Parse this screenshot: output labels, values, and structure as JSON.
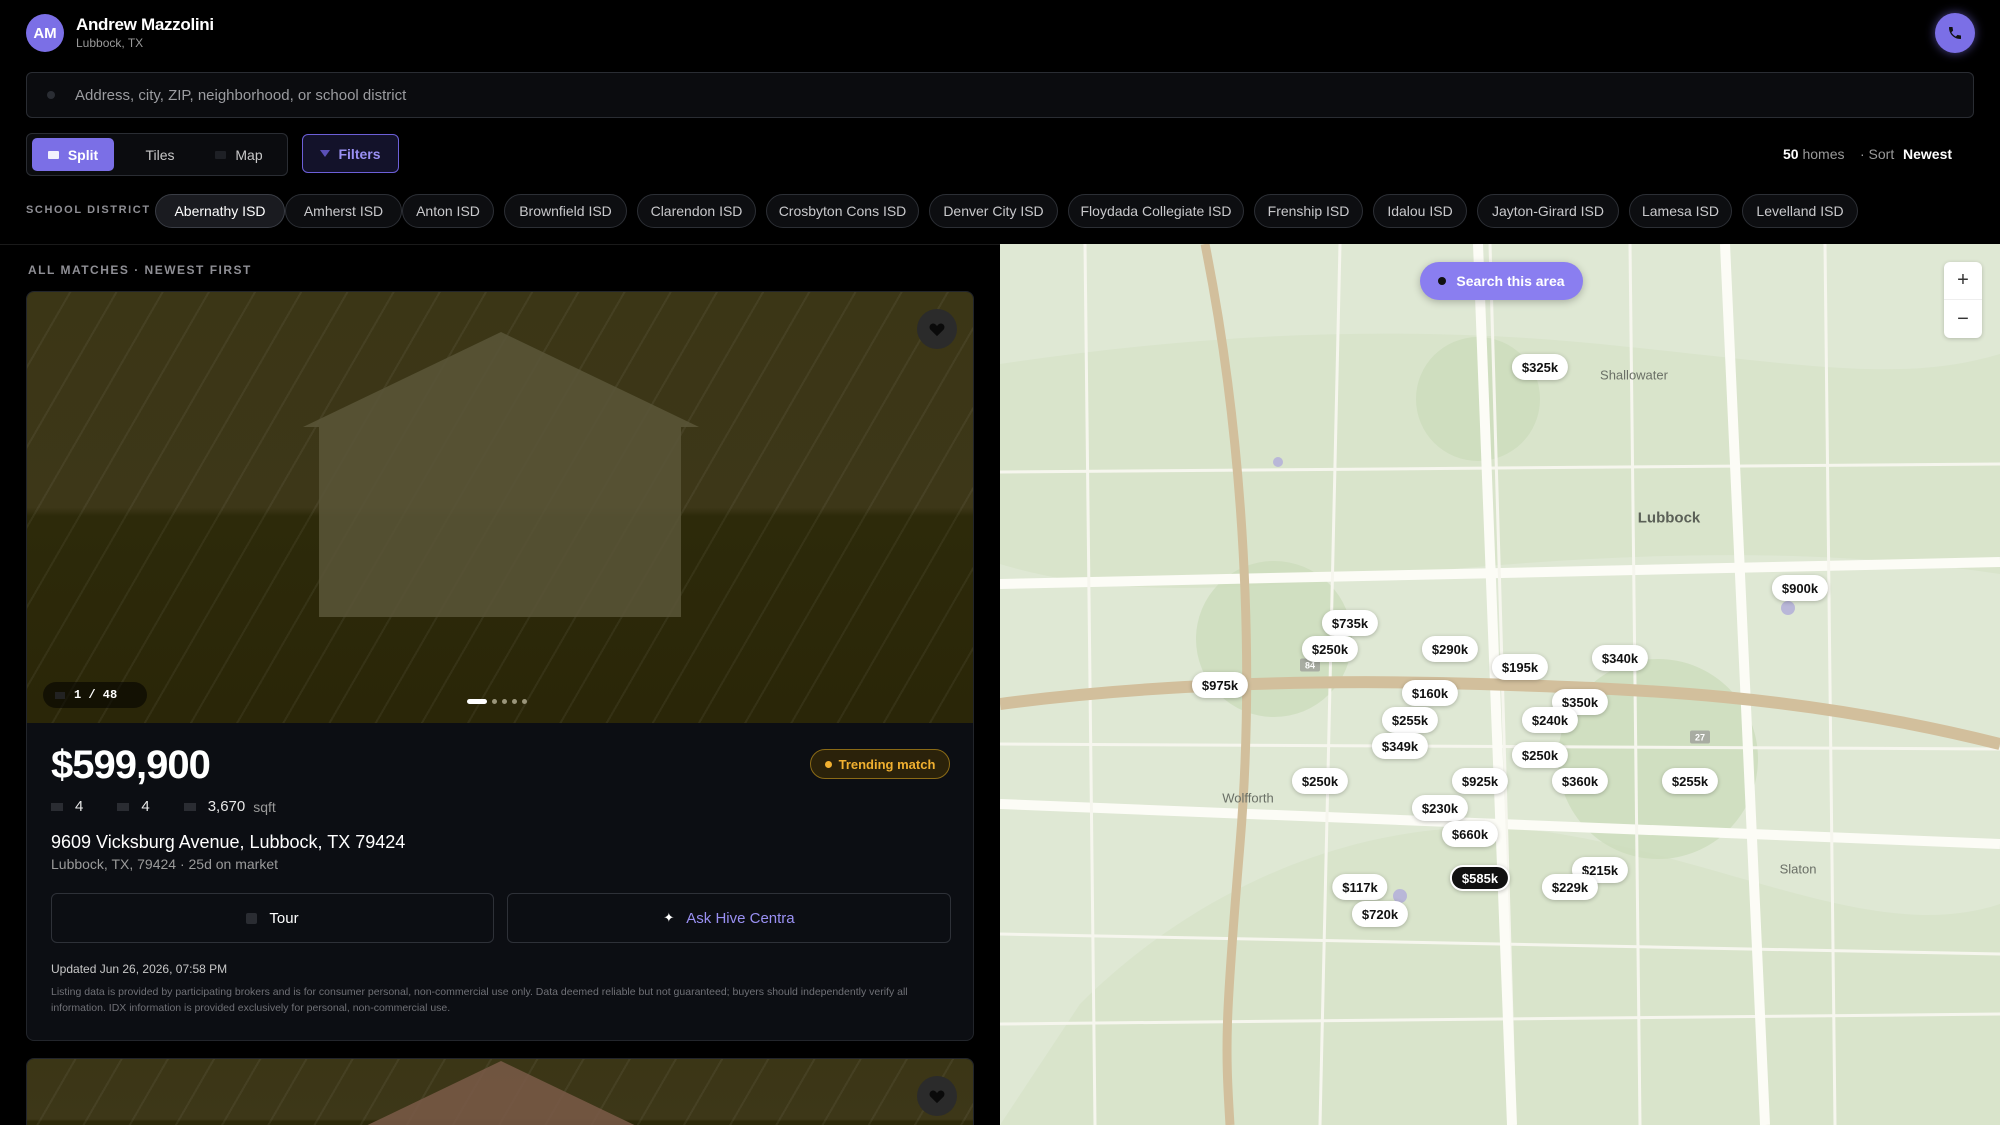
{
  "user": {
    "initials": "AM",
    "name": "Andrew Mazzolini",
    "location": "Lubbock, TX"
  },
  "search": {
    "placeholder": "Address, city, ZIP, neighborhood, or school district"
  },
  "view_modes": [
    {
      "label": "Split",
      "active": true
    },
    {
      "label": "Tiles",
      "active": false
    },
    {
      "label": "Map",
      "active": false
    }
  ],
  "filters_label": "Filters",
  "results": {
    "count": "50",
    "count_suffix": "homes",
    "sort_label": "· Sort",
    "sort_value": "Newest"
  },
  "school_district": {
    "label": "SCHOOL DISTRICT",
    "chips": [
      "Abernathy ISD",
      "Amherst ISD",
      "Anton ISD",
      "Brownfield ISD",
      "Clarendon ISD",
      "Crosbyton Cons ISD",
      "Denver City ISD",
      "Floydada Collegiate ISD",
      "Frenship ISD",
      "Idalou ISD",
      "Jayton-Girard ISD",
      "Lamesa ISD",
      "Levelland ISD"
    ],
    "active": "Abernathy ISD"
  },
  "list": {
    "header": "ALL MATCHES · NEWEST FIRST",
    "listing": {
      "photo_counter": "1 / 48",
      "price": "$599,900",
      "badge": "Trending match",
      "beds": "4",
      "baths": "4",
      "sqft": "3,670",
      "sqft_unit": "sqft",
      "address": "9609 Vicksburg Avenue, Lubbock, TX 79424",
      "subline": "Lubbock, TX, 79424 · 25d on market",
      "tour_label": "Tour",
      "ask_label": "Ask Hive Centra",
      "updated": "Updated Jun 26, 2026, 07:58 PM",
      "disclaimer": "Listing data is provided by participating brokers and is for consumer personal, non-commercial use only. Data deemed reliable but not guaranteed; buyers should independently verify all information. IDX information is provided exclusively for personal, non-commercial use."
    }
  },
  "map": {
    "search_area_label": "Search this area",
    "zoom_in": "+",
    "zoom_out": "−",
    "places": {
      "shallowater": "Shallowater",
      "lubbock": "Lubbock",
      "wolfforth": "Wolfforth",
      "slaton": "Slaton"
    },
    "highway_shields": [
      "84",
      "27"
    ],
    "pins": [
      "$325k",
      "$900k",
      "$735k",
      "$250k",
      "$290k",
      "$195k",
      "$340k",
      "$975k",
      "$160k",
      "$350k",
      "$255k",
      "$240k",
      "$349k",
      "$250k",
      "$250k",
      "$925k",
      "$360k",
      "$255k",
      "$230k",
      "$660k",
      "$215k",
      "$117k",
      "$585k",
      "$229k",
      "$720k"
    ],
    "selected_pin": "$585k"
  }
}
